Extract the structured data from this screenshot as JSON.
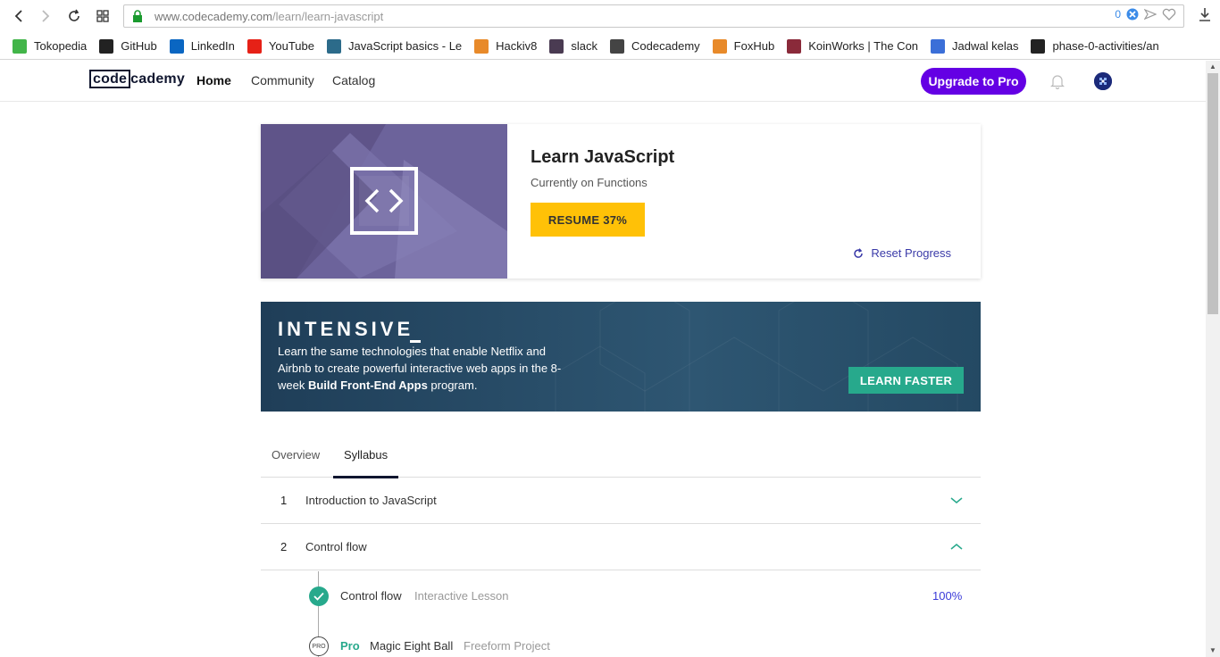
{
  "browser": {
    "url_host": "www.codecademy.com",
    "url_path": "/learn/learn-javascript",
    "addr_count": "0",
    "bookmarks": [
      {
        "label": "Tokopedia",
        "icon": "tokopedia-icon",
        "color": "#42b549"
      },
      {
        "label": "GitHub",
        "icon": "github-icon",
        "color": "#222222"
      },
      {
        "label": "LinkedIn",
        "icon": "linkedin-icon",
        "color": "#0a66c2"
      },
      {
        "label": "YouTube",
        "icon": "youtube-icon",
        "color": "#e62117"
      },
      {
        "label": "JavaScript basics - Le",
        "icon": "mdn-icon",
        "color": "#2c6b8a"
      },
      {
        "label": "Hackiv8",
        "icon": "fox-icon",
        "color": "#e88a2a"
      },
      {
        "label": "slack",
        "icon": "hash-icon",
        "color": "#4a3b52"
      },
      {
        "label": "Codecademy",
        "icon": "codecademy-icon",
        "color": "#444444"
      },
      {
        "label": "FoxHub",
        "icon": "fox-icon",
        "color": "#e88a2a"
      },
      {
        "label": "KoinWorks | The Con",
        "icon": "koinworks-icon",
        "color": "#8a2a3a"
      },
      {
        "label": "Jadwal kelas",
        "icon": "calendar-icon",
        "color": "#3b6fd8"
      },
      {
        "label": "phase-0-activities/an",
        "icon": "github-icon",
        "color": "#222222"
      }
    ]
  },
  "site": {
    "logo_code": "code",
    "logo_rest": "cademy",
    "nav": [
      "Home",
      "Community",
      "Catalog"
    ],
    "upgrade_label": "Upgrade to Pro",
    "brand_color": "#6400e4"
  },
  "course": {
    "title": "Learn JavaScript",
    "subtitle": "Currently on Functions",
    "resume_label": "RESUME 37%",
    "progress_percent": 37,
    "reset_label": "Reset Progress"
  },
  "intensive": {
    "title": "INTENSIVE",
    "desc_prefix": "Learn the same technologies that enable Netflix and Airbnb to create powerful interactive web apps in the 8-week ",
    "desc_bold": "Build Front-End Apps",
    "desc_suffix": " program.",
    "button_label": "LEARN FASTER"
  },
  "tabs": [
    "Overview",
    "Syllabus"
  ],
  "syllabus": {
    "modules": [
      {
        "num": "1",
        "title": "Introduction to JavaScript",
        "expanded": false
      },
      {
        "num": "2",
        "title": "Control flow",
        "expanded": true
      }
    ],
    "lessons": [
      {
        "title": "Control flow",
        "type": "Interactive Lesson",
        "progress": "100%",
        "status": "complete"
      },
      {
        "pro_label": "Pro",
        "badge": "PRO",
        "title": "Magic Eight Ball",
        "type": "Freeform Project"
      }
    ]
  }
}
